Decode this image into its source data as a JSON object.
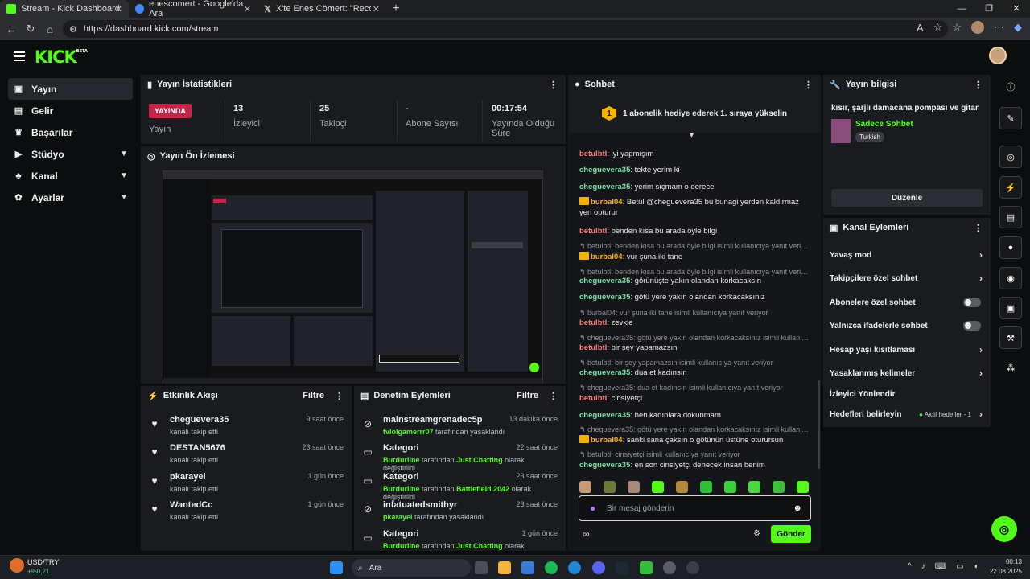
{
  "browser": {
    "tabs": [
      {
        "title": "Stream - Kick Dashboard",
        "favicon_color": "#53fc18",
        "active": true
      },
      {
        "title": "enescomert - Google'da Ara",
        "favicon_color": "#4285f4",
        "active": false
      },
      {
        "title": "X'te Enes Cömert: \"Record ve A B",
        "favicon_color": "#ffffff",
        "active": false
      }
    ],
    "url": "https://dashboard.kick.com/stream"
  },
  "app": {
    "logo": "KICK",
    "logo_badge": "BETA"
  },
  "sidebar": {
    "items": [
      {
        "label": "Yayın",
        "icon": "broadcast-icon",
        "glyph": "▣",
        "active": true,
        "expand": false
      },
      {
        "label": "Gelir",
        "icon": "revenue-icon",
        "glyph": "▤",
        "active": false,
        "expand": false
      },
      {
        "label": "Başarılar",
        "icon": "trophy-icon",
        "glyph": "♛",
        "active": false,
        "expand": false
      },
      {
        "label": "Stüdyo",
        "icon": "studio-icon",
        "glyph": "▶",
        "active": false,
        "expand": true
      },
      {
        "label": "Kanal",
        "icon": "channel-icon",
        "glyph": "♣",
        "active": false,
        "expand": true
      },
      {
        "label": "Ayarlar",
        "icon": "settings-icon",
        "glyph": "✿",
        "active": false,
        "expand": true
      }
    ]
  },
  "stats": {
    "title": "Yayın İstatistikleri",
    "live_badge": "YAYINDA",
    "items": [
      {
        "value": "",
        "label": "Yayın"
      },
      {
        "value": "13",
        "label": "İzleyici"
      },
      {
        "value": "25",
        "label": "Takipçi"
      },
      {
        "value": "-",
        "label": "Abone Sayısı"
      },
      {
        "value": "00:17:54",
        "label": "Yayında Olduğu Süre"
      }
    ]
  },
  "preview": {
    "title": "Yayın Ön İzlemesi"
  },
  "activity": {
    "title": "Etkinlik Akışı",
    "filter": "Filtre",
    "items": [
      {
        "name": "cheguevera35",
        "action": "kanalı takip etti",
        "time": "9 saat önce"
      },
      {
        "name": "DESTAN5676",
        "action": "kanalı takip etti",
        "time": "23 saat önce"
      },
      {
        "name": "pkarayel",
        "action": "kanalı takip etti",
        "time": "1 gün önce"
      },
      {
        "name": "WantedCc",
        "action": "kanalı takip etti",
        "time": "1 gün önce"
      }
    ]
  },
  "moderation": {
    "title": "Denetim Eylemleri",
    "filter": "Filtre",
    "items": [
      {
        "name": "mainstreamgrenadec5p",
        "icon": "ban-icon",
        "glyph": "⊘",
        "user": "tvlolgamerrr07",
        "rest": "tarafından yasaklandı",
        "mid": "",
        "tail": "",
        "time": "13 dakika önce"
      },
      {
        "name": "Kategori",
        "icon": "category-icon",
        "glyph": "▭",
        "user": "Burdurline",
        "rest": "tarafından",
        "mid": "Just Chatting",
        "tail": "olarak değiştirildi",
        "time": "22 saat önce"
      },
      {
        "name": "Kategori",
        "icon": "category-icon",
        "glyph": "▭",
        "user": "Burdurline",
        "rest": "tarafından",
        "mid": "Battlefield 2042",
        "tail": "olarak değiştirildi",
        "time": "23 saat önce"
      },
      {
        "name": "infatuatedsmithyr",
        "icon": "ban-icon",
        "glyph": "⊘",
        "user": "pkarayel",
        "rest": "tarafından yasaklandı",
        "mid": "",
        "tail": "",
        "time": "23 saat önce"
      },
      {
        "name": "Kategori",
        "icon": "category-icon",
        "glyph": "▭",
        "user": "Burdurline",
        "rest": "tarafından",
        "mid": "Just Chatting",
        "tail": "olarak değiştirildi",
        "time": "1 gün önce"
      }
    ]
  },
  "chat": {
    "title": "Sohbet",
    "gift_badge": "1",
    "gift_text": "1 abonelik hediye ederek 1. sıraya yükselin",
    "input_placeholder": "Bir mesaj gönderin",
    "send_label": "Gönder",
    "messages": [
      {
        "type": "msg",
        "user": "betulbtl",
        "color": "#ff7a7a",
        "text": "iyi yapmışım",
        "crown": false
      },
      {
        "type": "msg",
        "user": "cheguevera35",
        "color": "#7fe0a8",
        "text": "tekte yerim ki",
        "crown": false
      },
      {
        "type": "msg",
        "user": "cheguevera35",
        "color": "#7fe0a8",
        "text": "yerim sıçmam o derece",
        "crown": false
      },
      {
        "type": "msg",
        "user": "burbal04",
        "color": "#f4b400",
        "text": "Betül @cheguevera35 bu bunagi yerden kaldırmaz yeri opturur",
        "crown": true
      },
      {
        "type": "msg",
        "user": "betulbtl",
        "color": "#ff7a7a",
        "text": "benden kısa bu arada öyle bilgi",
        "crown": false
      },
      {
        "type": "reply",
        "text": "↰ betulbtl: benden kısa bu arada öyle bilgi isimli kullanıcıya yanıt veriyor"
      },
      {
        "type": "msg",
        "user": "burbal04",
        "color": "#f4b400",
        "text": "vur şuna iki tane",
        "crown": true
      },
      {
        "type": "reply",
        "text": "↰ betulbtl: benden kısa bu arada öyle bilgi isimli kullanıcıya yanıt veriyor"
      },
      {
        "type": "msg",
        "user": "cheguevera35",
        "color": "#7fe0a8",
        "text": "görünüşte yakın olandan korkacaksın",
        "crown": false
      },
      {
        "type": "msg",
        "user": "cheguevera35",
        "color": "#7fe0a8",
        "text": "götü yere yakın olandan korkacaksınız",
        "crown": false
      },
      {
        "type": "reply",
        "text": "↰ burbal04: vur şuna iki tane isimli kullanıcıya yanıt veriyor"
      },
      {
        "type": "msg",
        "user": "betulbtl",
        "color": "#ff7a7a",
        "text": "zevkle",
        "crown": false
      },
      {
        "type": "reply",
        "text": "↰ cheguevera35: götü yere yakın olandan korkacaksınız isimli kullanı..."
      },
      {
        "type": "msg",
        "user": "betulbtl",
        "color": "#ff7a7a",
        "text": "bir şey yapamazsın",
        "crown": false
      },
      {
        "type": "reply",
        "text": "↰ betulbtl: bir şey yapamazsın isimli kullanıcıya yanıt veriyor"
      },
      {
        "type": "msg",
        "user": "cheguevera35",
        "color": "#7fe0a8",
        "text": "dua et kadınsın",
        "crown": false
      },
      {
        "type": "reply",
        "text": "↰ cheguevera35: dua et kadınsın isimli kullanıcıya yanıt veriyor"
      },
      {
        "type": "msg",
        "user": "betulbtl",
        "color": "#ff7a7a",
        "text": "cinsiyetçi",
        "crown": false
      },
      {
        "type": "msg",
        "user": "cheguevera35",
        "color": "#7fe0a8",
        "text": "ben kadınlara dokunmam",
        "crown": false
      },
      {
        "type": "reply",
        "text": "↰ cheguevera35: götü yere yakın olandan korkacaksınız isimli kullanı..."
      },
      {
        "type": "msg",
        "user": "burbal04",
        "color": "#f4b400",
        "text": "sanki sana çaksın o götünün üstüne oturursun",
        "crown": true
      },
      {
        "type": "reply",
        "text": "↰ betulbtl: cinsiyetçi isimli kullanıcıya yanıt veriyor"
      },
      {
        "type": "msg",
        "user": "cheguevera35",
        "color": "#7fe0a8",
        "text": "en son cinsiyetçi denecek insan benim",
        "crown": false
      }
    ]
  },
  "stream_info": {
    "title": "Yayın bilgisi",
    "stream_title": "kısır, şarjlı damacana pompası ve gitar",
    "category": "Sadece Sohbet",
    "language": "Turkish",
    "edit_label": "Düzenle"
  },
  "channel_actions": {
    "title": "Kanal Eylemleri",
    "items": [
      {
        "label": "Yavaş mod",
        "control": "chevron",
        "extra": ""
      },
      {
        "label": "Takipçilere özel sohbet",
        "control": "chevron",
        "extra": ""
      },
      {
        "label": "Abonelere özel sohbet",
        "control": "toggle",
        "extra": ""
      },
      {
        "label": "Yalnızca ifadelerle sohbet",
        "control": "toggle",
        "extra": ""
      },
      {
        "label": "Hesap yaşı kısıtlaması",
        "control": "chevron",
        "extra": ""
      },
      {
        "label": "Yasaklanmış kelimeler",
        "control": "chevron",
        "extra": ""
      },
      {
        "label": "İzleyici Yönlendir",
        "control": "none",
        "extra": ""
      },
      {
        "label": "Hedefleri belirleyin",
        "control": "chevron",
        "extra": "Aktif hedefler - 1"
      }
    ]
  },
  "taskbar": {
    "ticker_name": "USD/TRY",
    "ticker_change": "+%0,21",
    "search_placeholder": "Ara",
    "time": "00:13",
    "date": "22.08.2025"
  },
  "colors": {
    "accent": "#53fc18",
    "live": "#c2274a",
    "panel": "#191b1f",
    "bg": "#0b0e0f"
  }
}
